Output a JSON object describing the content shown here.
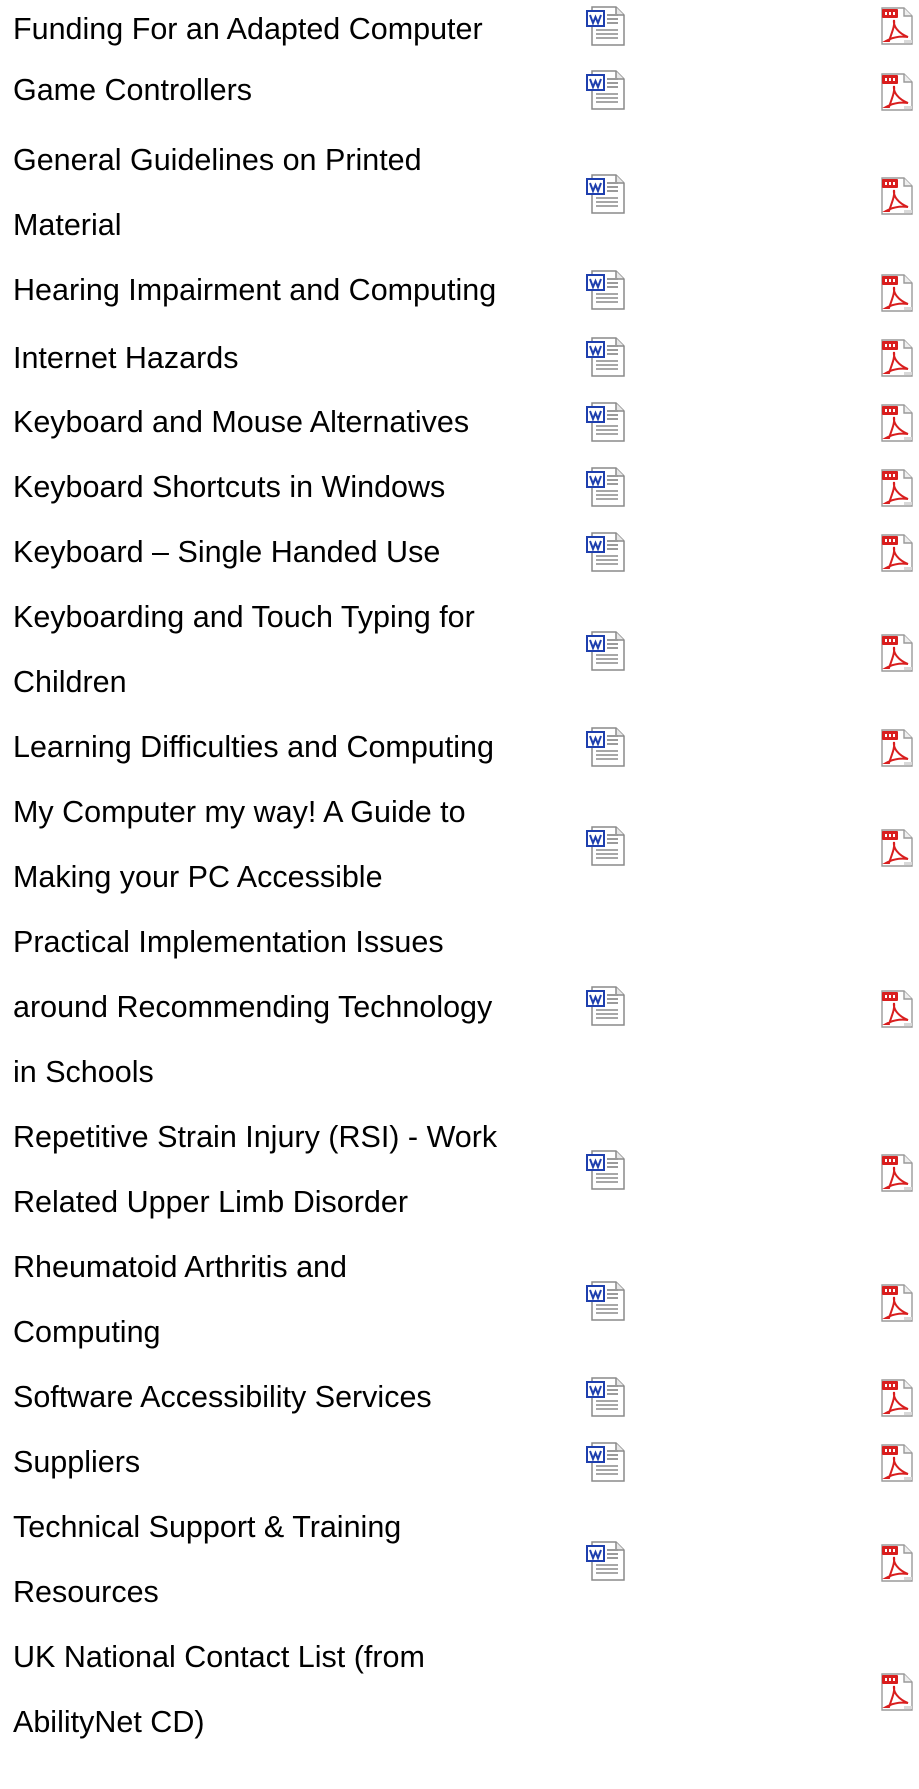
{
  "icons": {
    "word": "word-document-icon",
    "pdf": "pdf-document-icon",
    "word_color": "#1e3fae",
    "pdf_color": "#d91e1e"
  },
  "documents": [
    {
      "title": "Funding For an Adapted Computer",
      "word_icon": "word-document-icon",
      "pdf_icon": "pdf-document-icon"
    },
    {
      "title": "Game Controllers",
      "word_icon": "word-document-icon",
      "pdf_icon": "pdf-document-icon"
    },
    {
      "title": "General Guidelines on Printed\nMaterial",
      "word_icon": "word-document-icon",
      "pdf_icon": "pdf-document-icon"
    },
    {
      "title": "Hearing Impairment and Computing",
      "word_icon": "word-document-icon",
      "pdf_icon": "pdf-document-icon"
    },
    {
      "title": "Internet Hazards",
      "word_icon": "word-document-icon",
      "pdf_icon": "pdf-document-icon"
    },
    {
      "title": "Keyboard and Mouse Alternatives",
      "word_icon": "word-document-icon",
      "pdf_icon": "pdf-document-icon"
    },
    {
      "title": "Keyboard Shortcuts in Windows",
      "word_icon": "word-document-icon",
      "pdf_icon": "pdf-document-icon"
    },
    {
      "title": "Keyboard – Single Handed Use",
      "word_icon": "word-document-icon",
      "pdf_icon": "pdf-document-icon"
    },
    {
      "title": "Keyboarding and Touch Typing for\nChildren",
      "word_icon": "word-document-icon",
      "pdf_icon": "pdf-document-icon"
    },
    {
      "title": "Learning Difficulties and Computing",
      "word_icon": "word-document-icon",
      "pdf_icon": "pdf-document-icon"
    },
    {
      "title": "My Computer my way! A Guide to\nMaking your PC Accessible",
      "word_icon": "word-document-icon",
      "pdf_icon": "pdf-document-icon"
    },
    {
      "title": "Practical Implementation Issues\naround Recommending Technology\nin Schools",
      "word_icon": "word-document-icon",
      "pdf_icon": "pdf-document-icon"
    },
    {
      "title": "Repetitive Strain Injury (RSI) - Work\nRelated Upper Limb Disorder",
      "word_icon": "word-document-icon",
      "pdf_icon": "pdf-document-icon"
    },
    {
      "title": "Rheumatoid Arthritis and\nComputing",
      "word_icon": "word-document-icon",
      "pdf_icon": "pdf-document-icon"
    },
    {
      "title": "Software Accessibility Services",
      "word_icon": "word-document-icon",
      "pdf_icon": "pdf-document-icon"
    },
    {
      "title": "Suppliers",
      "word_icon": "word-document-icon",
      "pdf_icon": "pdf-document-icon"
    },
    {
      "title": "Technical Support & Training\nResources",
      "word_icon": "word-document-icon",
      "pdf_icon": "pdf-document-icon"
    },
    {
      "title": "UK National Contact List (from\nAbilityNet CD)",
      "word_icon": null,
      "pdf_icon": "pdf-document-icon"
    }
  ]
}
